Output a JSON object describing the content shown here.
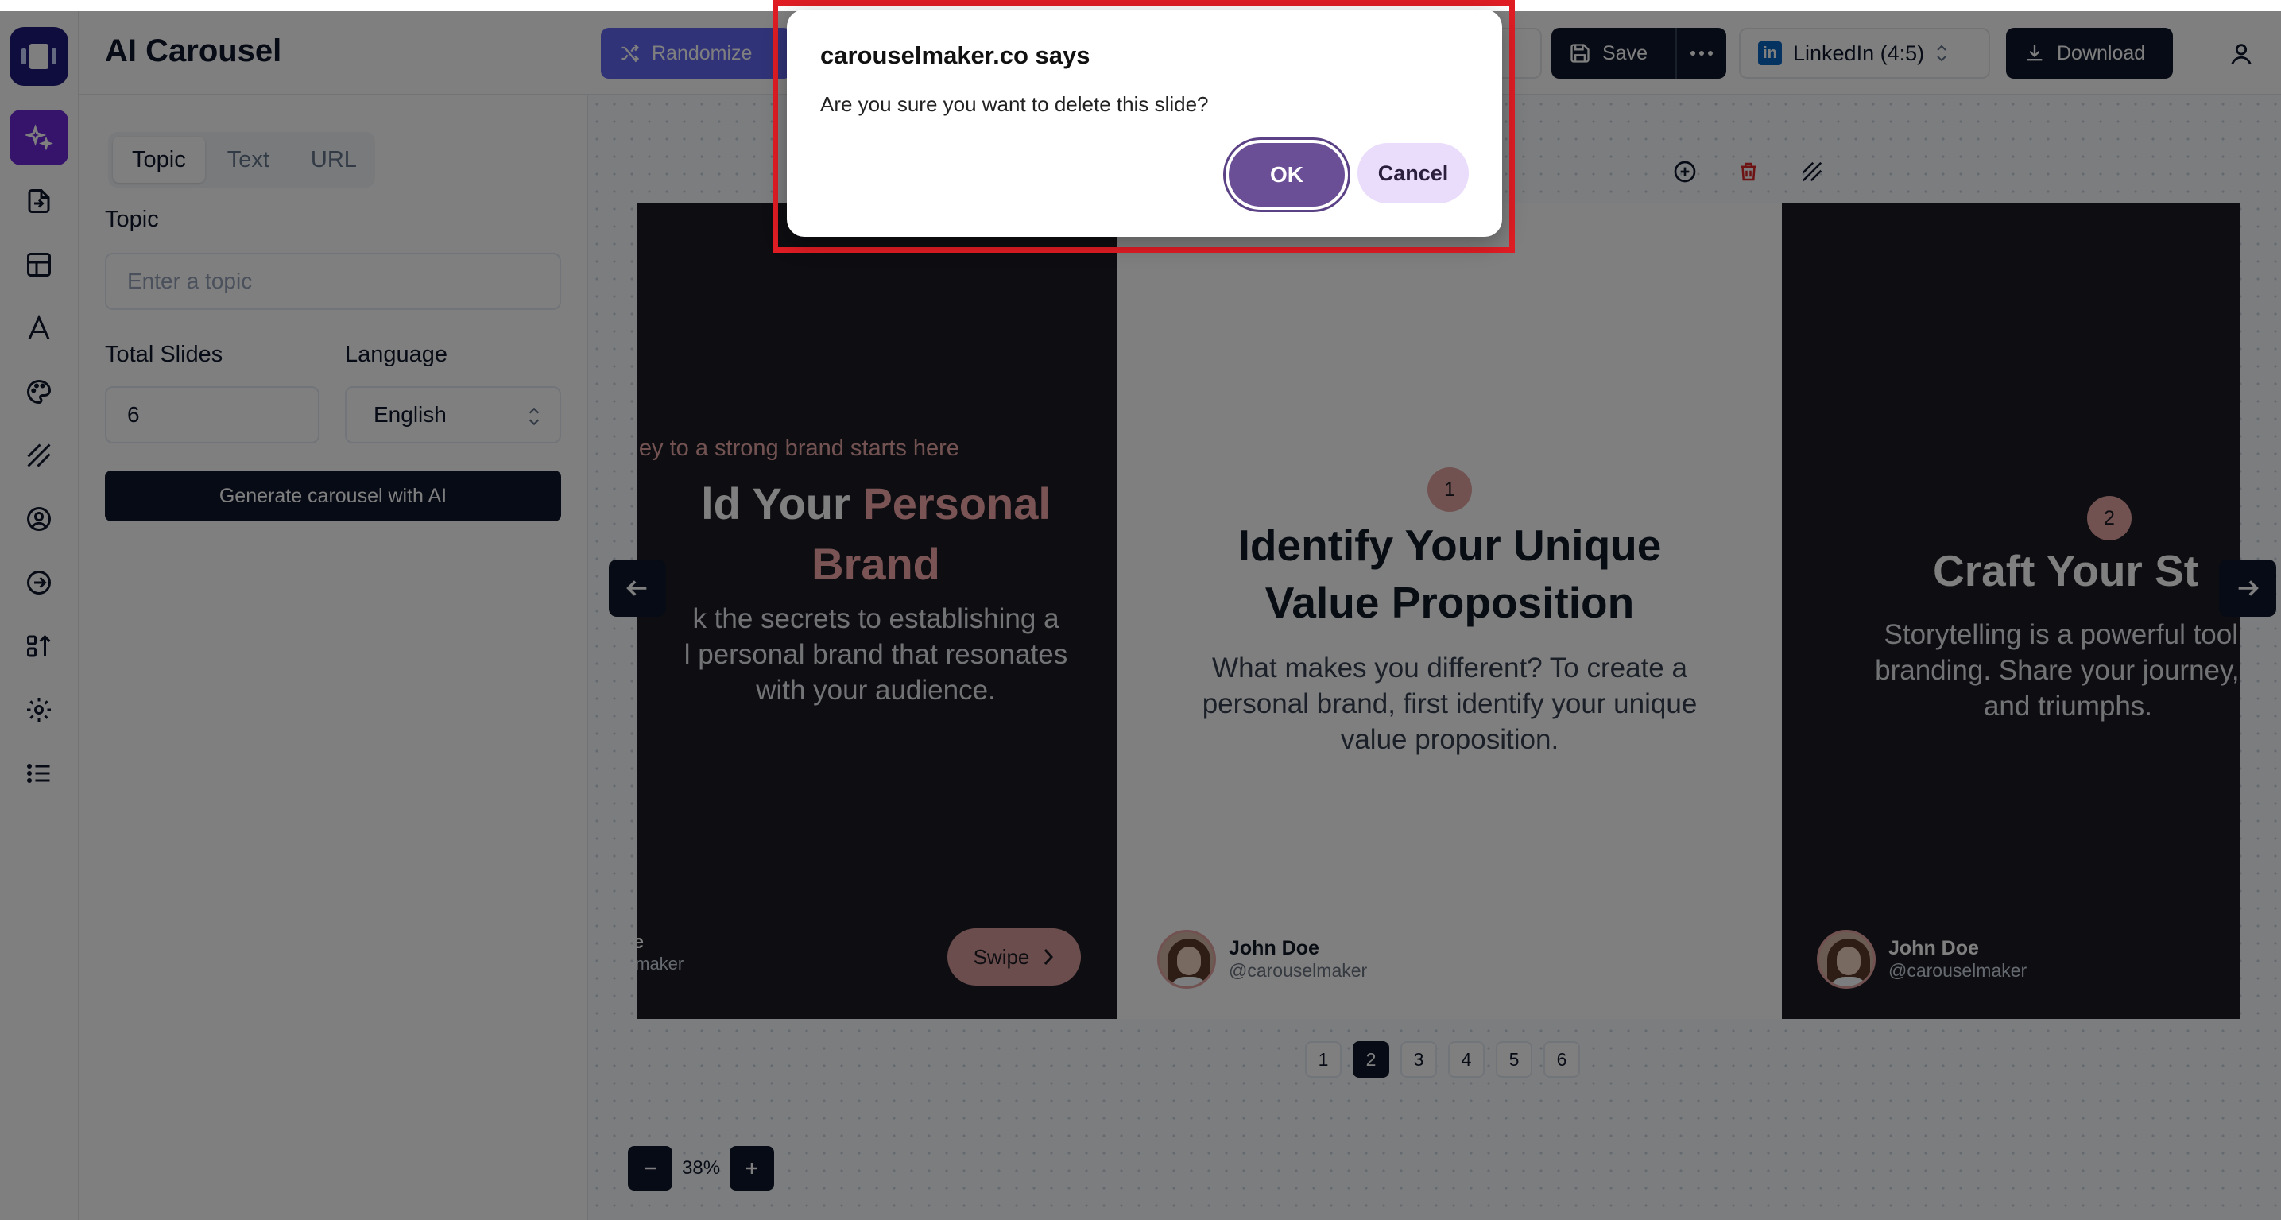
{
  "app": {
    "title": "AI Carousel",
    "accent_color": "#6366f1",
    "dark_color": "#0f172a"
  },
  "header": {
    "randomize_label": "Randomize",
    "save_label": "Save",
    "format_label": "LinkedIn (4:5)",
    "download_label": "Download"
  },
  "sidebar": {
    "items": [
      {
        "icon": "sparkles-icon"
      },
      {
        "icon": "file-import-icon"
      },
      {
        "icon": "layout-icon"
      },
      {
        "icon": "font-icon"
      },
      {
        "icon": "palette-icon"
      },
      {
        "icon": "pattern-icon"
      },
      {
        "icon": "user-circle-icon"
      },
      {
        "icon": "arrow-circle-icon"
      },
      {
        "icon": "sort-icon"
      },
      {
        "icon": "gear-icon"
      },
      {
        "icon": "list-icon"
      }
    ]
  },
  "panel": {
    "tabs": [
      "Topic",
      "Text",
      "URL"
    ],
    "active_tab": "Topic",
    "topic_label": "Topic",
    "topic_placeholder": "Enter a topic",
    "total_slides_label": "Total Slides",
    "total_slides_value": "6",
    "language_label": "Language",
    "language_value": "English",
    "generate_label": "Generate carousel with AI"
  },
  "slides": {
    "s1": {
      "tagline": "urney to a strong brand starts here",
      "title_plain": "ld Your ",
      "title_accent_1": "Personal",
      "title_accent_2": "Brand",
      "body_1": "k the secrets to establishing a",
      "body_2": "l personal brand that resonates",
      "body_3": "with your audience.",
      "author_name": "oe",
      "author_handle": "elmaker",
      "swipe_label": "Swipe"
    },
    "s2": {
      "number": "1",
      "title_1": "Identify Your Unique",
      "title_2": "Value Proposition",
      "body_1": "What makes you different? To create a",
      "body_2": "personal brand, first identify your unique",
      "body_3": "value proposition.",
      "author_name": "John Doe",
      "author_handle": "@carouselmaker"
    },
    "s3": {
      "number": "2",
      "title": "Craft Your St",
      "body_1": "Storytelling is a powerful tool i",
      "body_2": "branding. Share your journey, c",
      "body_3": "and triumphs.",
      "author_name": "John Doe",
      "author_handle": "@carouselmaker"
    }
  },
  "pager": {
    "pages": [
      "1",
      "2",
      "3",
      "4",
      "5",
      "6"
    ],
    "active": "2"
  },
  "zoom": {
    "value": "38%"
  },
  "dialog": {
    "title": "carouselmaker.co says",
    "message": "Are you sure you want to delete this slide?",
    "ok_label": "OK",
    "cancel_label": "Cancel"
  }
}
